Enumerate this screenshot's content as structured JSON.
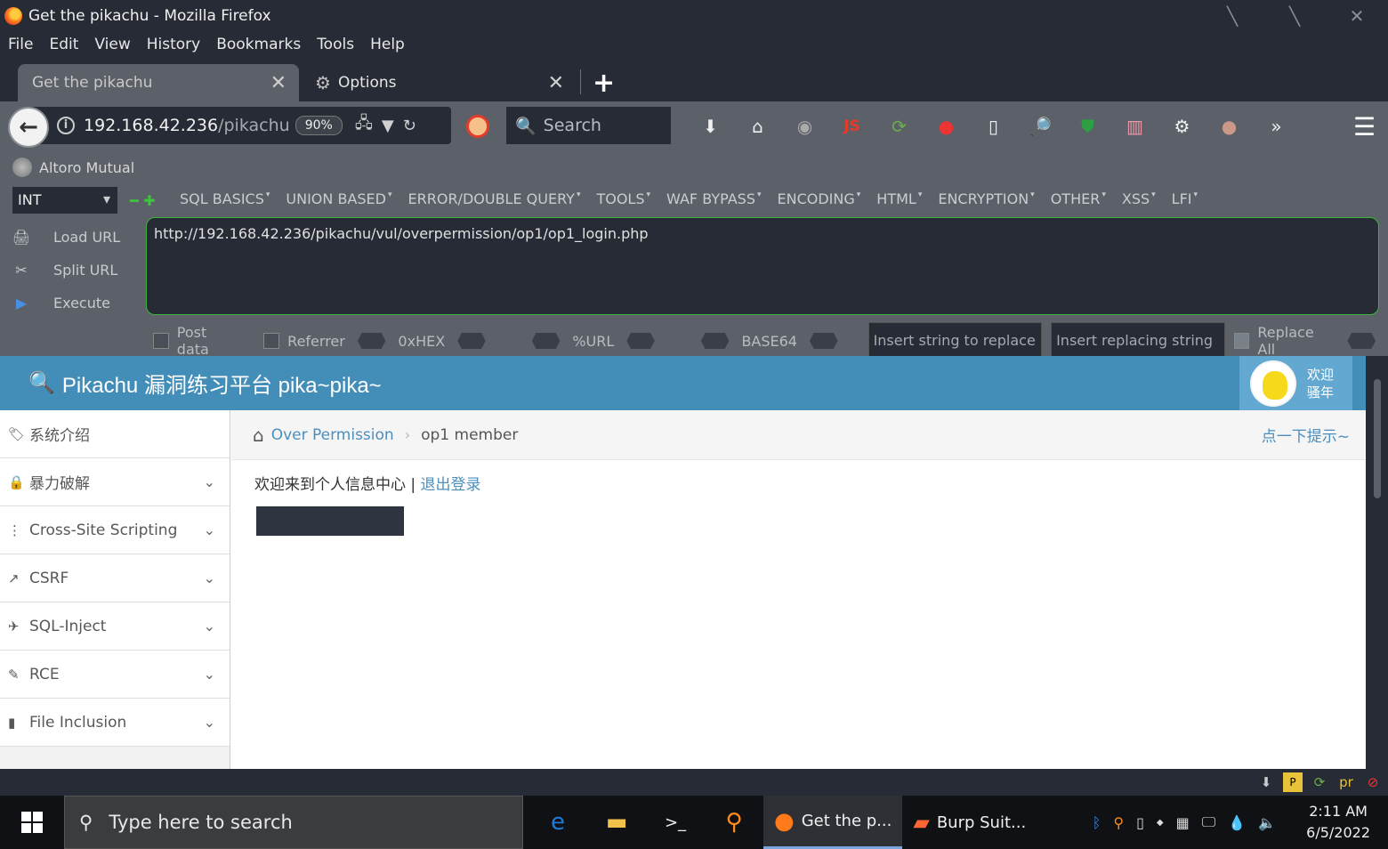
{
  "window": {
    "title": "Get the pikachu - Mozilla Firefox"
  },
  "menubar": [
    "File",
    "Edit",
    "View",
    "History",
    "Bookmarks",
    "Tools",
    "Help"
  ],
  "tabs": [
    {
      "label": "Get the pikachu",
      "active": true
    },
    {
      "label": "Options",
      "active": false
    }
  ],
  "navbar": {
    "url_host": "192.168.42.236",
    "url_path": "/pikachu",
    "zoom": "90%",
    "search_placeholder": "Search",
    "js_label": "JS"
  },
  "bookmarks": [
    {
      "label": "Altoro Mutual"
    }
  ],
  "hackbar": {
    "select_value": "INT",
    "menus": [
      "SQL BASICS",
      "UNION BASED",
      "ERROR/DOUBLE QUERY",
      "TOOLS",
      "WAF BYPASS",
      "ENCODING",
      "HTML",
      "ENCRYPTION",
      "OTHER",
      "XSS",
      "LFI"
    ],
    "actions": [
      "Load URL",
      "Split URL",
      "Execute"
    ],
    "url_value": "http://192.168.42.236/pikachu/vul/overpermission/op1/op1_login.php",
    "post_data_label": "Post data",
    "referrer_label": "Referrer",
    "hex_label": "0xHEX",
    "url_enc_label": "%URL",
    "base64_label": "BASE64",
    "replace_placeholder": "Insert string to replace",
    "replacing_placeholder": "Insert replacing string",
    "replace_all_label": "Replace All"
  },
  "page": {
    "brand": "Pikachu 漏洞练习平台 pika~pika~",
    "user_line1": "欢迎",
    "user_line2": "骚年",
    "sidebar": [
      {
        "label": "系统介绍",
        "icon": "tag-icon",
        "glyph": "🏷"
      },
      {
        "label": "暴力破解",
        "icon": "lock-icon",
        "glyph": "🔒"
      },
      {
        "label": "Cross-Site Scripting",
        "icon": "sitemap-icon",
        "glyph": "⋮"
      },
      {
        "label": "CSRF",
        "icon": "external-link-icon",
        "glyph": "↗"
      },
      {
        "label": "SQL-Inject",
        "icon": "plane-icon",
        "glyph": "✈"
      },
      {
        "label": "RCE",
        "icon": "pencil-icon",
        "glyph": "✎"
      },
      {
        "label": "File Inclusion",
        "icon": "file-icon",
        "glyph": "▮"
      }
    ],
    "breadcrumb": {
      "link": "Over Permission",
      "current": "op1 member",
      "tip": "点一下提示~"
    },
    "welcome_text": "欢迎来到个人信息中心",
    "separator": "|",
    "logout_label": "退出登录"
  },
  "taskbar": {
    "search_placeholder": "Type here to search",
    "tasks": [
      {
        "label": "Get the p...",
        "icon": "firefox-icon"
      },
      {
        "label": "Burp Suit...",
        "icon": "burp-icon"
      }
    ],
    "time": "2:11 AM",
    "date": "6/5/2022"
  }
}
